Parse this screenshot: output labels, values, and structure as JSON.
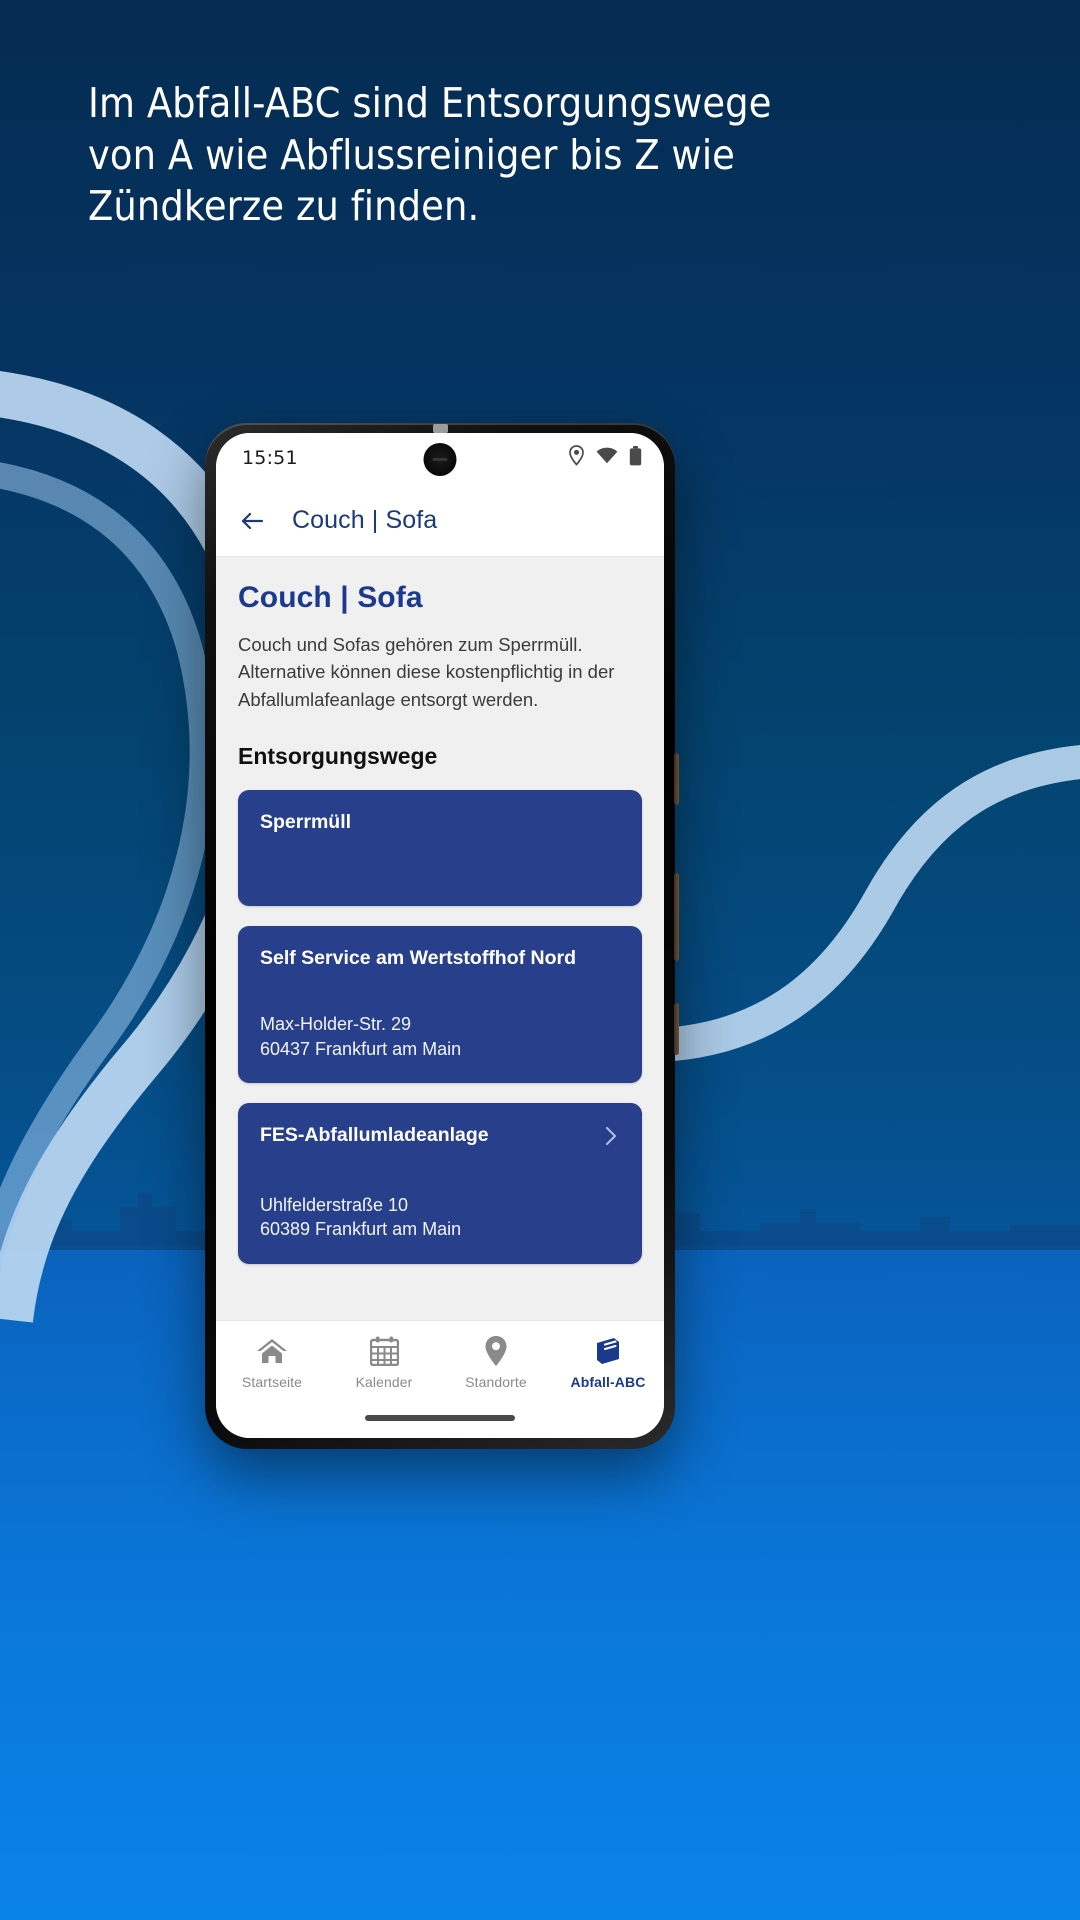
{
  "promo": {
    "headline_lines": [
      "Im Abfall-ABC sind Entsorgungswege",
      "von A wie Abflussreiniger bis Z wie",
      "Zündkerze zu finden."
    ],
    "background_color": "#063461",
    "accent_color": "#0a78da"
  },
  "phone": {
    "statusbar": {
      "time": "15:51",
      "icons": [
        "location-pin-icon",
        "wifi-icon",
        "battery-icon"
      ]
    },
    "appbar": {
      "back_label": "Zurück",
      "title": "Couch | Sofa"
    },
    "screen": {
      "page_title": "Couch | Sofa",
      "description": "Couch und Sofas gehören zum Sperrmüll. Alternative können diese kostenpflichtig in der Abfallumlafeanlage entsorgt werden.",
      "section_title": "Entsorgungswege",
      "cards": [
        {
          "title": "Sperrmüll",
          "address_line1": "",
          "address_line2": "",
          "has_chevron": false,
          "color": "#28408c"
        },
        {
          "title": "Self Service am Wertstoffhof Nord",
          "address_line1": "Max-Holder-Str. 29",
          "address_line2": "60437 Frankfurt am Main",
          "has_chevron": false,
          "color": "#28408c"
        },
        {
          "title": "FES-Abfallumladeanlage",
          "address_line1": "Uhlfelderstraße 10",
          "address_line2": "60389 Frankfurt am Main",
          "has_chevron": true,
          "color": "#28408c"
        }
      ]
    },
    "bottomnav": {
      "items": [
        {
          "label": "Startseite",
          "icon": "home-icon",
          "active": false
        },
        {
          "label": "Kalender",
          "icon": "calendar-icon",
          "active": false
        },
        {
          "label": "Standorte",
          "icon": "map-pin-icon",
          "active": false
        },
        {
          "label": "Abfall-ABC",
          "icon": "book-icon",
          "active": true
        }
      ],
      "active_color": "#1b3a8f",
      "inactive_color": "#8a8a8a"
    }
  }
}
